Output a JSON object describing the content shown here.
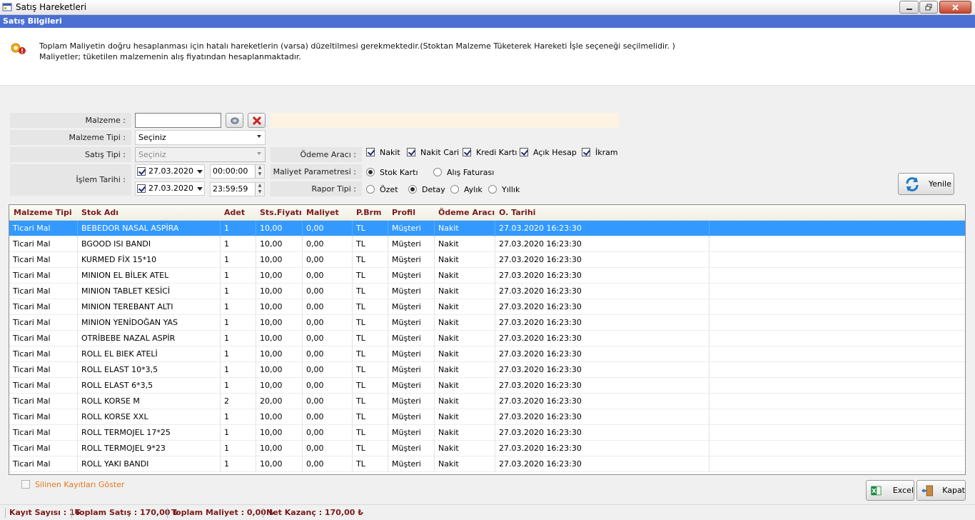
{
  "window": {
    "title": "Satış Hareketleri",
    "section_header": "Satış Bilgileri"
  },
  "info": {
    "line1": "Toplam Maliyetin doğru hesaplanması için hatalı hareketlerin (varsa) düzeltilmesi gerekmektedir.(Stoktan Malzeme Tüketerek Hareketi İşle seçeneği seçilmelidir. )",
    "line2": "Maliyetler;  tüketilen malzemenin alış fiyatından hesaplanmaktadır."
  },
  "filters": {
    "malzeme_label": "Malzeme :",
    "malzeme_value": "",
    "malzeme_tipi_label": "Malzeme Tipi  :",
    "malzeme_tipi_value": "Seçiniz",
    "satis_tipi_label": "Satış Tipi :",
    "satis_tipi_value": "Seçiniz",
    "islem_tarihi_label": "İşlem Tarihi :",
    "date_start": "27.03.2020",
    "time_start": "00:00:00",
    "date_end": "27.03.2020",
    "time_end": "23:59:59",
    "odeme_araci_label": "Ödeme Aracı :",
    "odeme_options": [
      "Nakit",
      "Nakit Cari",
      "Kredi Kartı",
      "Açık Hesap",
      "İkram"
    ],
    "maliyet_param_label": "Maliyet Parametresi :",
    "maliyet_options": [
      "Stok Kartı",
      "Alış Faturası"
    ],
    "maliyet_selected": "Stok Kartı",
    "rapor_tipi_label": "Rapor Tipi :",
    "rapor_options": [
      "Özet",
      "Detay",
      "Aylık",
      "Yıllık"
    ],
    "rapor_selected": "Detay",
    "refresh_label": "Yenile"
  },
  "grid": {
    "columns": [
      "Malzeme Tipi",
      "Stok Adı",
      "Adet",
      "Sts.Fiyatı",
      "Maliyet",
      "P.Brm",
      "Profil",
      "Ödeme Aracı",
      "O. Tarihi"
    ],
    "rows": [
      [
        "Ticari Mal",
        "BEBEDOR NASAL ASPİRA",
        "1",
        "10,00",
        "0,00",
        "TL",
        "Müşteri",
        "Nakit",
        "27.03.2020 16:23:30"
      ],
      [
        "Ticari Mal",
        "BGOOD ISI BANDI",
        "1",
        "10,00",
        "0,00",
        "TL",
        "Müşteri",
        "Nakit",
        "27.03.2020 16:23:30"
      ],
      [
        "Ticari Mal",
        "KURMED FİX 15*10",
        "1",
        "10,00",
        "0,00",
        "TL",
        "Müşteri",
        "Nakit",
        "27.03.2020 16:23:30"
      ],
      [
        "Ticari Mal",
        "MINION EL BİLEK ATEL",
        "1",
        "10,00",
        "0,00",
        "TL",
        "Müşteri",
        "Nakit",
        "27.03.2020 16:23:30"
      ],
      [
        "Ticari Mal",
        "MINION TABLET KESİCİ",
        "1",
        "10,00",
        "0,00",
        "TL",
        "Müşteri",
        "Nakit",
        "27.03.2020 16:23:30"
      ],
      [
        "Ticari Mal",
        "MINION TEREBANT ALTI",
        "1",
        "10,00",
        "0,00",
        "TL",
        "Müşteri",
        "Nakit",
        "27.03.2020 16:23:30"
      ],
      [
        "Ticari Mal",
        "MINION YENİDOĞAN YAS",
        "1",
        "10,00",
        "0,00",
        "TL",
        "Müşteri",
        "Nakit",
        "27.03.2020 16:23:30"
      ],
      [
        "Ticari Mal",
        "OTRİBEBE NAZAL ASPİR",
        "1",
        "10,00",
        "0,00",
        "TL",
        "Müşteri",
        "Nakit",
        "27.03.2020 16:23:30"
      ],
      [
        "Ticari Mal",
        "ROLL EL BIEK ATELİ",
        "1",
        "10,00",
        "0,00",
        "TL",
        "Müşteri",
        "Nakit",
        "27.03.2020 16:23:30"
      ],
      [
        "Ticari Mal",
        "ROLL ELAST 10*3,5",
        "1",
        "10,00",
        "0,00",
        "TL",
        "Müşteri",
        "Nakit",
        "27.03.2020 16:23:30"
      ],
      [
        "Ticari Mal",
        "ROLL ELAST 6*3,5",
        "1",
        "10,00",
        "0,00",
        "TL",
        "Müşteri",
        "Nakit",
        "27.03.2020 16:23:30"
      ],
      [
        "Ticari Mal",
        "ROLL KORSE M",
        "2",
        "20,00",
        "0,00",
        "TL",
        "Müşteri",
        "Nakit",
        "27.03.2020 16:23:30"
      ],
      [
        "Ticari Mal",
        "ROLL KORSE XXL",
        "1",
        "10,00",
        "0,00",
        "TL",
        "Müşteri",
        "Nakit",
        "27.03.2020 16:23:30"
      ],
      [
        "Ticari Mal",
        "ROLL TERMOJEL 17*25",
        "1",
        "10,00",
        "0,00",
        "TL",
        "Müşteri",
        "Nakit",
        "27.03.2020 16:23:30"
      ],
      [
        "Ticari Mal",
        "ROLL TERMOJEL 9*23",
        "1",
        "10,00",
        "0,00",
        "TL",
        "Müşteri",
        "Nakit",
        "27.03.2020 16:23:30"
      ],
      [
        "Ticari Mal",
        "ROLL YAKI BANDI",
        "1",
        "10,00",
        "0,00",
        "TL",
        "Müşteri",
        "Nakit",
        "27.03.2020 16:23:30"
      ]
    ],
    "selected_row": 0
  },
  "footer": {
    "show_deleted_label": "Silinen Kayıtları Göster",
    "excel_label": "Excel",
    "close_label": "Kapat"
  },
  "status": {
    "kayit_sayisi": "Kayıt Sayısı : 16",
    "toplam_satis": "Toplam Satış : 170,00 ₺",
    "toplam_maliyet": "Toplam Maliyet : 0,00 ₺",
    "net_kazanc": "Net Kazanç : 170,00 ₺"
  },
  "colors": {
    "section_header": "#4b6fd3",
    "selected_row": "#3399ff",
    "header_text": "#7a1b1b",
    "deleted_link": "#e07a1f"
  }
}
